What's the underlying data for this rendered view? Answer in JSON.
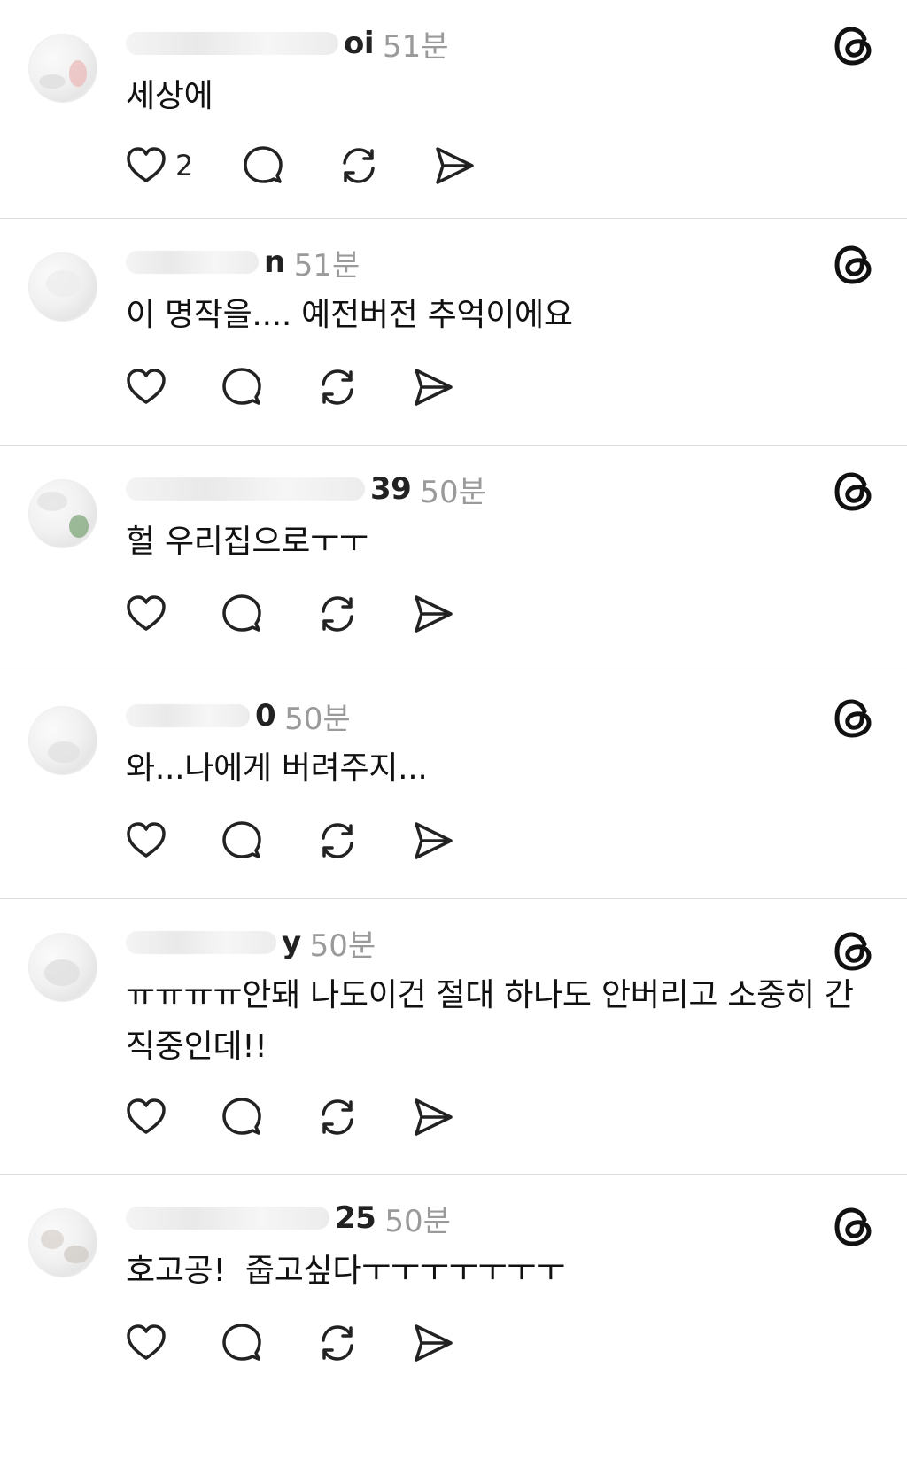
{
  "posts": [
    {
      "username": "oi",
      "time": "51분",
      "text": "세상에",
      "likes": "2"
    },
    {
      "username": "n",
      "time": "51분",
      "text": "이 명작을.... 예전버전 추억이에요",
      "likes": ""
    },
    {
      "username": "39",
      "time": "50분",
      "text": "헐 우리집으로ㅜㅜ",
      "likes": ""
    },
    {
      "username": "0",
      "time": "50분",
      "text": "와...나에게 버려주지...",
      "likes": ""
    },
    {
      "username": "y",
      "time": "50분",
      "text": "ㅠㅠㅠㅠ안돼 나도이건 절대 하나도 안버리고 소중히 간직중인데!!",
      "likes": ""
    },
    {
      "username": "25",
      "time": "50분",
      "text": "호고공!  줍고싶다ㅜㅜㅜㅜㅜㅜㅜ",
      "likes": ""
    }
  ],
  "icons": {
    "like": "heart-icon",
    "reply": "comment-bubble-icon",
    "repost": "repost-icon",
    "share": "send-icon",
    "app": "threads-logo-icon"
  },
  "colors": {
    "text": "#111111",
    "muted": "#9a9a9a",
    "divider": "#dedede"
  }
}
